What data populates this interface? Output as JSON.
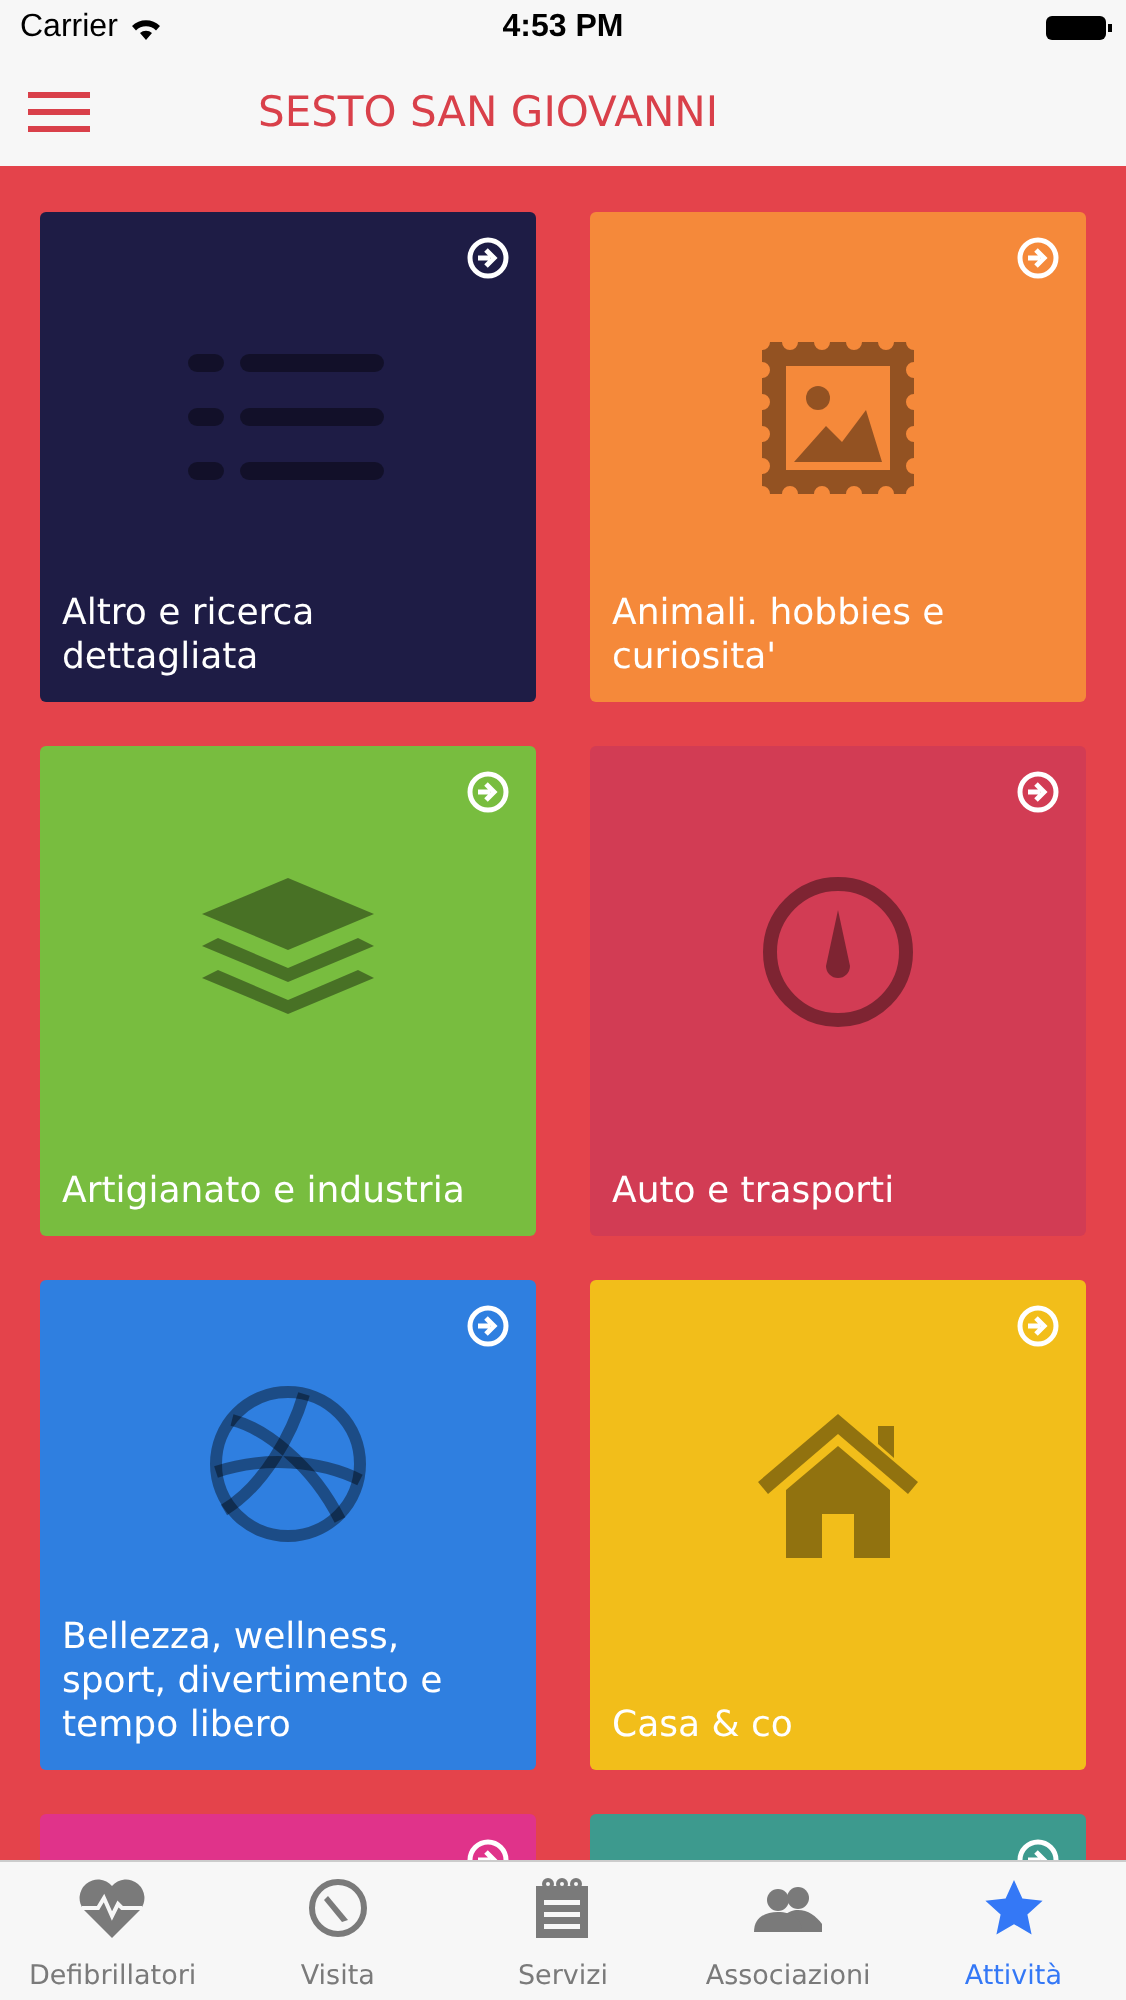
{
  "status_bar": {
    "carrier": "Carrier",
    "time": "4:53 PM"
  },
  "header": {
    "title": "SESTO SAN GIOVANNI"
  },
  "tiles": [
    {
      "kind": "list",
      "label": "Altro e ricerca dettagliata",
      "color": "#1e1c45"
    },
    {
      "kind": "picture",
      "label": "Animali. hobbies e curiosita'",
      "color": "#f5893a"
    },
    {
      "kind": "layers",
      "label": "Artigianato e industria",
      "color": "#78bd3f"
    },
    {
      "kind": "gauge",
      "label": "Auto e trasporti",
      "color": "#d23c54"
    },
    {
      "kind": "ball",
      "label": "Bellezza, wellness, sport, divertimento e tempo libero",
      "color": "#2f7fe0"
    },
    {
      "kind": "house",
      "label": "Casa & co",
      "color": "#f2be1a"
    },
    {
      "kind": "none",
      "color": "#e0338a"
    },
    {
      "kind": "none",
      "color": "#3d9a8e"
    }
  ],
  "tab_bar": [
    {
      "kind": "heart",
      "label": "Defibrillatori",
      "selected": false
    },
    {
      "kind": "compass",
      "label": "Visita",
      "selected": false
    },
    {
      "kind": "notepad",
      "label": "Servizi",
      "selected": false
    },
    {
      "kind": "people",
      "label": "Associazioni",
      "selected": false
    },
    {
      "kind": "star",
      "label": "Attività",
      "selected": true
    }
  ]
}
